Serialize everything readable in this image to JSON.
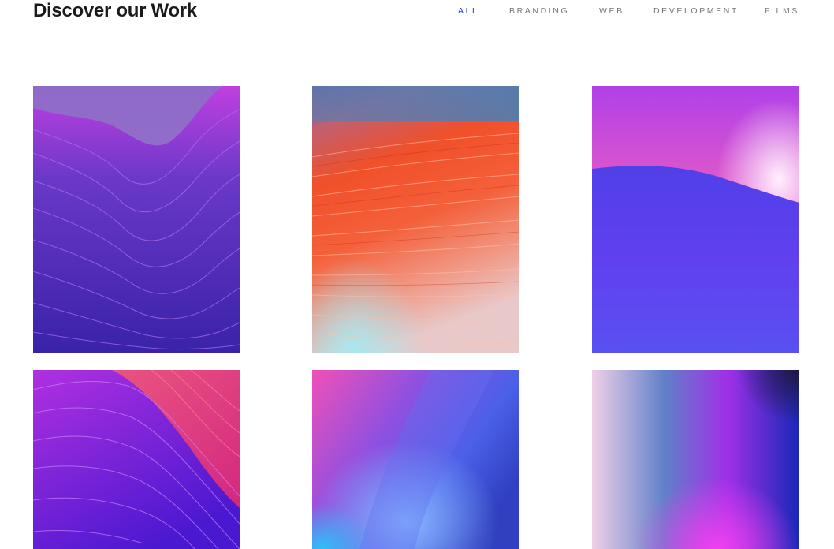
{
  "header": {
    "title": "Discover our Work"
  },
  "filters": {
    "items": [
      {
        "label": "ALL",
        "active": true
      },
      {
        "label": "BRANDING",
        "active": false
      },
      {
        "label": "WEB",
        "active": false
      },
      {
        "label": "DEVELOPMENT",
        "active": false
      },
      {
        "label": "FILMS",
        "active": false
      }
    ]
  },
  "colors": {
    "active_filter": "#2233cc",
    "inactive_filter": "#777777",
    "title": "#1a1a1a"
  }
}
